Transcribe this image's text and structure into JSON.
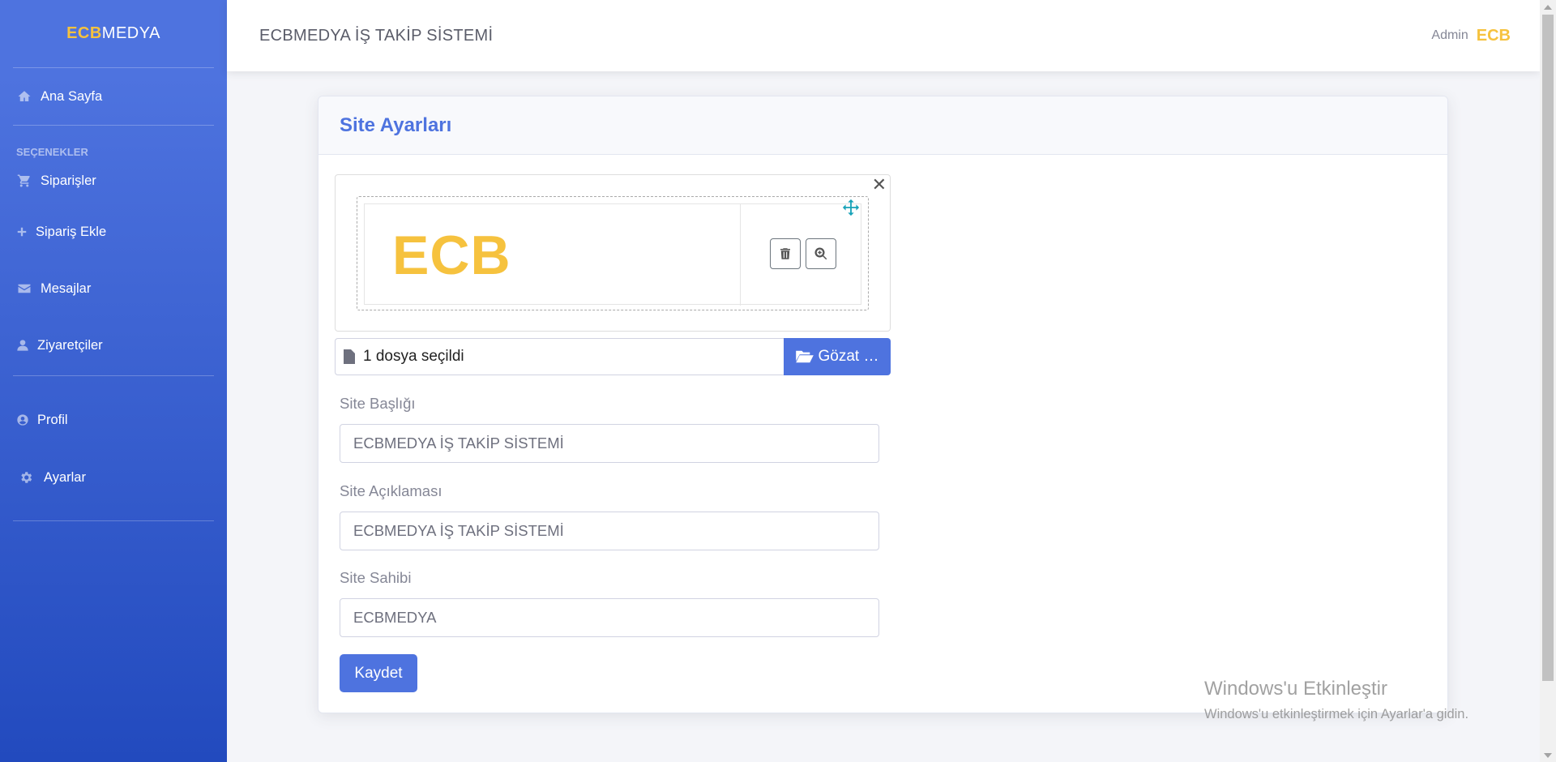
{
  "sidebar": {
    "brand_part1": "ECB",
    "brand_part2": "MEDYA",
    "home": "Ana Sayfa",
    "heading": "SEÇENEKLER",
    "items": [
      {
        "label": "Siparişler",
        "icon": "shopping-cart-icon"
      },
      {
        "label": "Sipariş Ekle",
        "icon": "plus-icon"
      },
      {
        "label": "Mesajlar",
        "icon": "envelope-icon"
      },
      {
        "label": "Ziyaretçiler",
        "icon": "user-icon"
      }
    ],
    "profile": "Profil",
    "settings": "Ayarlar"
  },
  "topbar": {
    "title": "ECBMEDYA İŞ TAKİP SİSTEMİ",
    "user_name": "Admin",
    "user_logo": "ECB"
  },
  "card": {
    "title": "Site Ayarları",
    "preview_logo_text": "ECB",
    "file_caption": "1 dosya seçildi",
    "browse_label": "Gözat …",
    "fields": [
      {
        "label": "Site Başlığı",
        "value": "ECBMEDYA İŞ TAKİP SİSTEMİ"
      },
      {
        "label": "Site Açıklaması",
        "value": "ECBMEDYA İŞ TAKİP SİSTEMİ"
      },
      {
        "label": "Site Sahibi",
        "value": "ECBMEDYA"
      }
    ],
    "save_label": "Kaydet"
  },
  "watermark": {
    "line1": "Windows'u Etkinleştir",
    "line2": "Windows'u etkinleştirmek için Ayarlar'a gidin."
  },
  "colors": {
    "primary": "#4e73df",
    "brand_yellow": "#f6c23e",
    "sidebar_dark": "#224abe"
  }
}
